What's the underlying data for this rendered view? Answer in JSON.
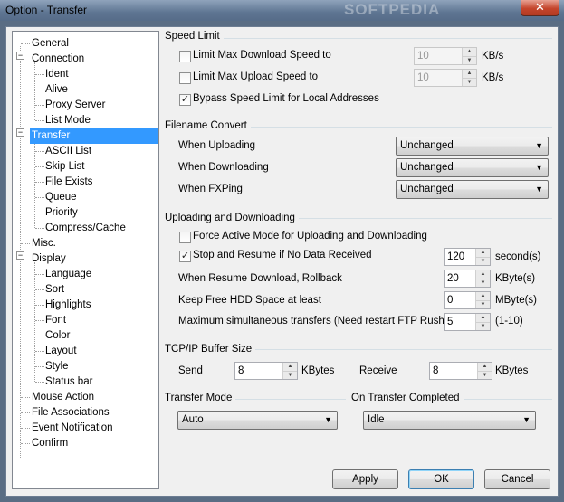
{
  "window": {
    "title": "Option - Transfer",
    "watermark": "SOFTPEDIA",
    "close_glyph": "✕"
  },
  "tree": {
    "expanded_glyph": "−",
    "items": [
      {
        "label": "General"
      },
      {
        "label": "Connection"
      },
      {
        "label": "Ident"
      },
      {
        "label": "Alive"
      },
      {
        "label": "Proxy Server"
      },
      {
        "label": "List Mode"
      },
      {
        "label": "Transfer"
      },
      {
        "label": "ASCII List"
      },
      {
        "label": "Skip List"
      },
      {
        "label": "File Exists"
      },
      {
        "label": "Queue"
      },
      {
        "label": "Priority"
      },
      {
        "label": "Compress/Cache"
      },
      {
        "label": "Misc."
      },
      {
        "label": "Display"
      },
      {
        "label": "Language"
      },
      {
        "label": "Sort"
      },
      {
        "label": "Highlights"
      },
      {
        "label": "Font"
      },
      {
        "label": "Color"
      },
      {
        "label": "Layout"
      },
      {
        "label": "Style"
      },
      {
        "label": "Status bar"
      },
      {
        "label": "Mouse Action"
      },
      {
        "label": "File Associations"
      },
      {
        "label": "Event Notification"
      },
      {
        "label": "Confirm"
      }
    ]
  },
  "speed_limit": {
    "title": "Speed Limit",
    "download": {
      "label": "Limit Max Download Speed to",
      "value": "10",
      "unit": "KB/s",
      "checked": false
    },
    "upload": {
      "label": "Limit Max Upload Speed to",
      "value": "10",
      "unit": "KB/s",
      "checked": false
    },
    "bypass": {
      "label": "Bypass Speed Limit for Local Addresses",
      "checked": true
    }
  },
  "filename_convert": {
    "title": "Filename Convert",
    "uploading": {
      "label": "When Uploading",
      "value": "Unchanged"
    },
    "downloading": {
      "label": "When Downloading",
      "value": "Unchanged"
    },
    "fxping": {
      "label": "When FXPing",
      "value": "Unchanged"
    }
  },
  "up_down": {
    "title": "Uploading and Downloading",
    "force_active": {
      "label": "Force Active Mode for Uploading and Downloading",
      "checked": false
    },
    "stop_resume": {
      "label": "Stop and Resume if No Data Received",
      "value": "120",
      "unit": "second(s)",
      "checked": true
    },
    "rollback": {
      "label": "When Resume Download, Rollback",
      "value": "20",
      "unit": "KByte(s)"
    },
    "free_hdd": {
      "label": "Keep Free HDD Space at least",
      "value": "0",
      "unit": "MByte(s)"
    },
    "max_transfers": {
      "label": "Maximum simultaneous transfers (Need restart FTP Rush)",
      "value": "5",
      "range": "(1-10)"
    }
  },
  "tcp_buffer": {
    "title": "TCP/IP Buffer Size",
    "send": {
      "label": "Send",
      "value": "8",
      "unit": "KBytes"
    },
    "receive": {
      "label": "Receive",
      "value": "8",
      "unit": "KBytes"
    }
  },
  "transfer_mode": {
    "title": "Transfer Mode",
    "value": "Auto"
  },
  "on_completed": {
    "title": "On Transfer Completed",
    "value": "Idle"
  },
  "buttons": {
    "apply": "Apply",
    "ok": "OK",
    "cancel": "Cancel"
  },
  "glyphs": {
    "check": "✓",
    "up": "▲",
    "down": "▼"
  }
}
